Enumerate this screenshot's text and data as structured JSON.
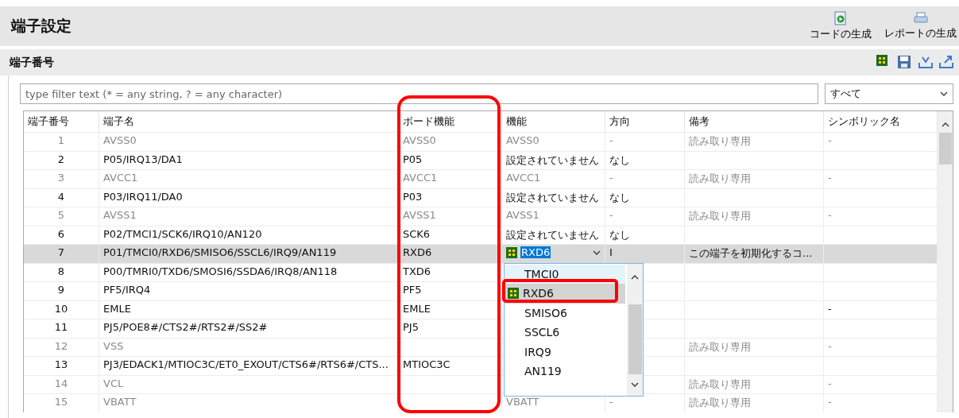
{
  "header": {
    "title": "端子設定",
    "actions": [
      {
        "label": "コードの生成",
        "kind": "code"
      },
      {
        "label": "レポートの生成",
        "kind": "report"
      }
    ]
  },
  "section": {
    "title": "端子番号",
    "tools": [
      {
        "kind": "chip"
      },
      {
        "kind": "save"
      },
      {
        "kind": "import"
      },
      {
        "kind": "export"
      }
    ]
  },
  "filter": {
    "placeholder": "type filter text (* = any string, ? = any character)",
    "scope": "すべて"
  },
  "table": {
    "columns": [
      "端子番号",
      "端子名",
      "ボード機能",
      "機能",
      "方向",
      "備考",
      "シンボリック名"
    ],
    "rows": [
      {
        "number": "1",
        "name": "AVSS0",
        "board": "AVSS0",
        "function": "AVSS0",
        "direction": "-",
        "note": "読み取り専用",
        "symbol": "-",
        "readonly": true,
        "selected": false
      },
      {
        "number": "2",
        "name": "P05/IRQ13/DA1",
        "board": "P05",
        "function": "設定されていません",
        "direction": "なし",
        "readonly": false,
        "selected": false
      },
      {
        "number": "3",
        "name": "AVCC1",
        "board": "AVCC1",
        "function": "AVCC1",
        "direction": "-",
        "note": "読み取り専用",
        "symbol": "-",
        "readonly": true,
        "selected": false
      },
      {
        "number": "4",
        "name": "P03/IRQ11/DA0",
        "board": "P03",
        "function": "設定されていません",
        "direction": "なし",
        "readonly": false,
        "selected": false
      },
      {
        "number": "5",
        "name": "AVSS1",
        "board": "AVSS1",
        "function": "AVSS1",
        "direction": "-",
        "note": "読み取り専用",
        "symbol": "-",
        "readonly": true,
        "selected": false
      },
      {
        "number": "6",
        "name": "P02/TMCI1/SCK6/IRQ10/AN120",
        "board": "SCK6",
        "function": "設定されていません",
        "direction": "なし",
        "readonly": false,
        "selected": false
      },
      {
        "number": "7",
        "name": "P01/TMCI0/RXD6/SMISO6/SSCL6/IRQ9/AN119",
        "board": "RXD6",
        "function": "RXD6",
        "editing": true,
        "direction": "I",
        "note": "この端子を初期化するコ...",
        "readonly": false,
        "selected": true
      },
      {
        "number": "8",
        "name": "P00/TMRI0/TXD6/SMOSI6/SSDA6/IRQ8/AN118",
        "board": "TXD6",
        "readonly": false,
        "selected": false
      },
      {
        "number": "9",
        "name": "PF5/IRQ4",
        "board": "PF5",
        "readonly": false,
        "selected": false
      },
      {
        "number": "10",
        "name": "EMLE",
        "board": "EMLE",
        "symbol": "-",
        "readonly": false,
        "selected": false
      },
      {
        "number": "11",
        "name": "PJ5/POE8#/CTS2#/RTS2#/SS2#",
        "board": "PJ5",
        "readonly": false,
        "selected": false
      },
      {
        "number": "12",
        "name": "VSS",
        "note": "読み取り専用",
        "symbol": "-",
        "readonly": true,
        "selected": false
      },
      {
        "number": "13",
        "name": "PJ3/EDACK1/MTIOC3C/ET0_EXOUT/CTS6#/RTS6#/CTS...",
        "board": "MTIOC3C",
        "readonly": false,
        "selected": false
      },
      {
        "number": "14",
        "name": "VCL",
        "note": "読み取り専用",
        "symbol": "-",
        "readonly": true,
        "selected": false
      },
      {
        "number": "15",
        "name": "VBATT",
        "function": "VBATT",
        "direction": "-",
        "note": "読み取り専用",
        "symbol": "-",
        "readonly": true,
        "selected": false
      }
    ]
  },
  "dropdown": {
    "items": [
      {
        "label": "TMCI0",
        "selected": false,
        "hovered": true,
        "icon": false
      },
      {
        "label": "RXD6",
        "selected": true,
        "hovered": false,
        "icon": true
      },
      {
        "label": "SMISO6",
        "selected": false,
        "hovered": false,
        "icon": false
      },
      {
        "label": "SSCL6",
        "selected": false,
        "hovered": false,
        "icon": false
      },
      {
        "label": "IRQ9",
        "selected": false,
        "hovered": false,
        "icon": false
      },
      {
        "label": "AN119",
        "selected": false,
        "hovered": false,
        "icon": false
      }
    ]
  }
}
